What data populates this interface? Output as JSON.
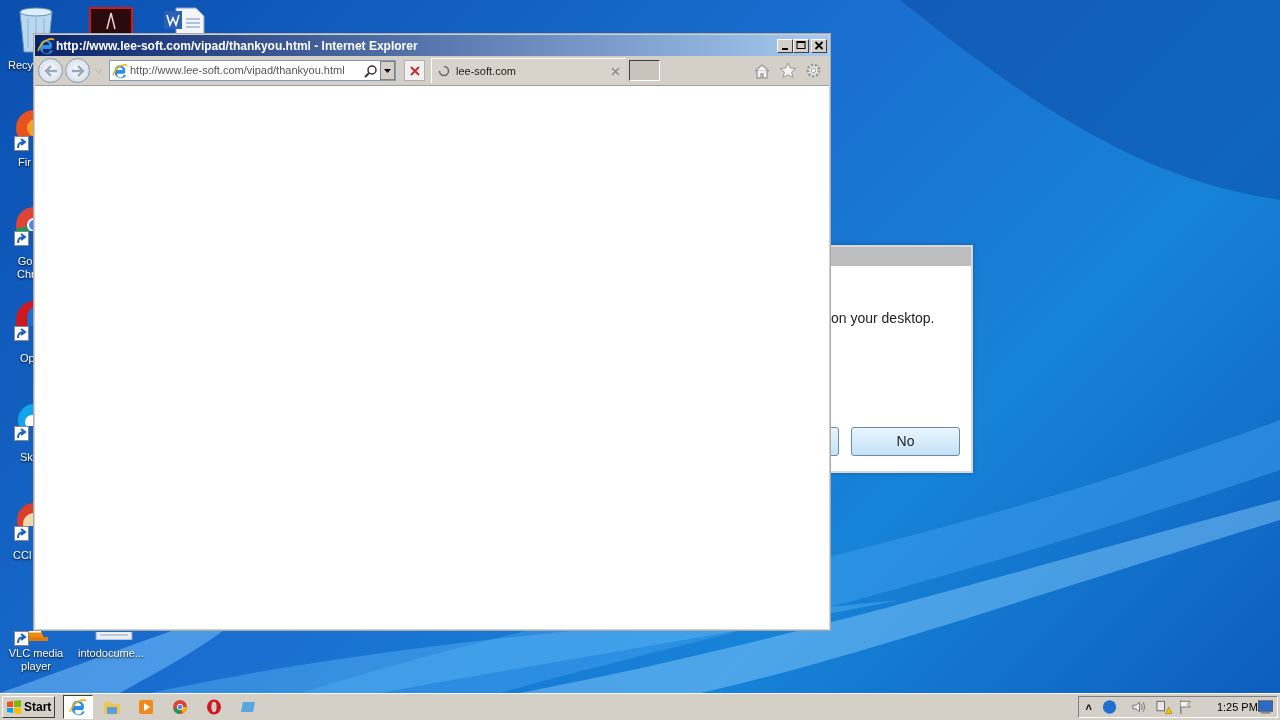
{
  "desktop_icons": [
    {
      "kind": "recycle-bin",
      "label": "Recy"
    },
    {
      "kind": "acrobat"
    },
    {
      "kind": "word"
    },
    {
      "kind": "firefox",
      "label": "Fir"
    },
    {
      "kind": "chrome",
      "label": "Go Chr"
    },
    {
      "kind": "opera",
      "label": "Op"
    },
    {
      "kind": "skype",
      "label": "Sk"
    },
    {
      "kind": "ccleaner",
      "label": "CCl"
    },
    {
      "kind": "vlc",
      "label": "VLC media player"
    },
    {
      "kind": "document",
      "label": "intodocume..."
    }
  ],
  "dialog": {
    "message": "on your desktop.",
    "buttons": [
      {
        "kind": "hidden"
      },
      {
        "kind": "text",
        "label": "No"
      }
    ]
  },
  "browser": {
    "title": "http://www.lee-soft.com/vipad/thankyou.html - Internet Explorer",
    "address": "http://www.lee-soft.com/vipad/thankyou.html",
    "tabs": [
      {
        "label": "lee-soft.com",
        "loading": true,
        "selected": true
      }
    ]
  },
  "taskbar": {
    "start": "Start",
    "apps": [
      {
        "kind": "ie",
        "selected": true
      },
      {
        "kind": "explorer",
        "selected": false
      },
      {
        "kind": "media",
        "selected": false
      },
      {
        "kind": "chrome",
        "selected": false
      },
      {
        "kind": "opera",
        "selected": false
      },
      {
        "kind": "generic",
        "selected": false
      }
    ],
    "tray": {
      "expand": "˄",
      "time": "1:25 PM"
    }
  }
}
